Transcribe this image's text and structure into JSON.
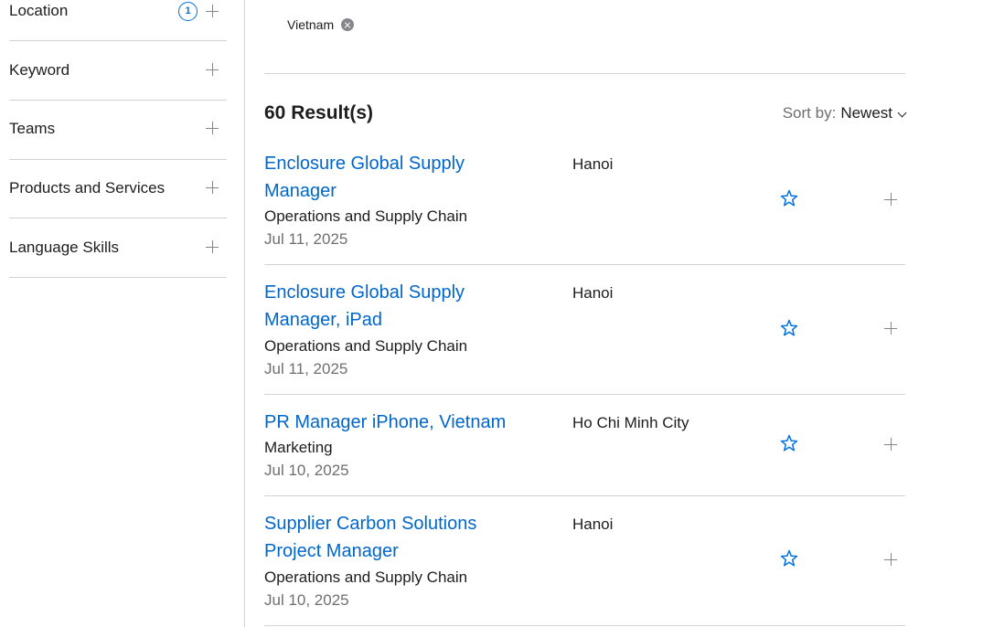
{
  "sidebar": {
    "filters": [
      {
        "label": "Location",
        "count": "1"
      },
      {
        "label": "Keyword"
      },
      {
        "label": "Teams"
      },
      {
        "label": "Products and Services"
      },
      {
        "label": "Language Skills"
      }
    ]
  },
  "active_filters": [
    {
      "label": "Vietnam"
    }
  ],
  "results": {
    "count_label": "60 Result(s)",
    "sort_label": "Sort by:",
    "sort_value": "Newest"
  },
  "jobs": [
    {
      "title": "Enclosure Global Supply Manager",
      "team": "Operations and Supply Chain",
      "date": "Jul 11, 2025",
      "location": "Hanoi"
    },
    {
      "title": "Enclosure Global Supply Manager, iPad",
      "team": "Operations and Supply Chain",
      "date": "Jul 11, 2025",
      "location": "Hanoi"
    },
    {
      "title": "PR Manager iPhone, Vietnam",
      "team": "Marketing",
      "date": "Jul 10, 2025",
      "location": "Ho Chi Minh City"
    },
    {
      "title": "Supplier Carbon Solutions Project Manager",
      "team": "Operations and Supply Chain",
      "date": "Jul 10, 2025",
      "location": "Hanoi"
    }
  ],
  "colors": {
    "link": "#0066cc",
    "accent": "#0071e3",
    "divider": "#d2d2d7"
  },
  "icons": {
    "expand": "plus-icon",
    "favorite": "star-outline-icon",
    "remove_filter": "close-circle-icon",
    "sort": "chevron-down-icon"
  }
}
